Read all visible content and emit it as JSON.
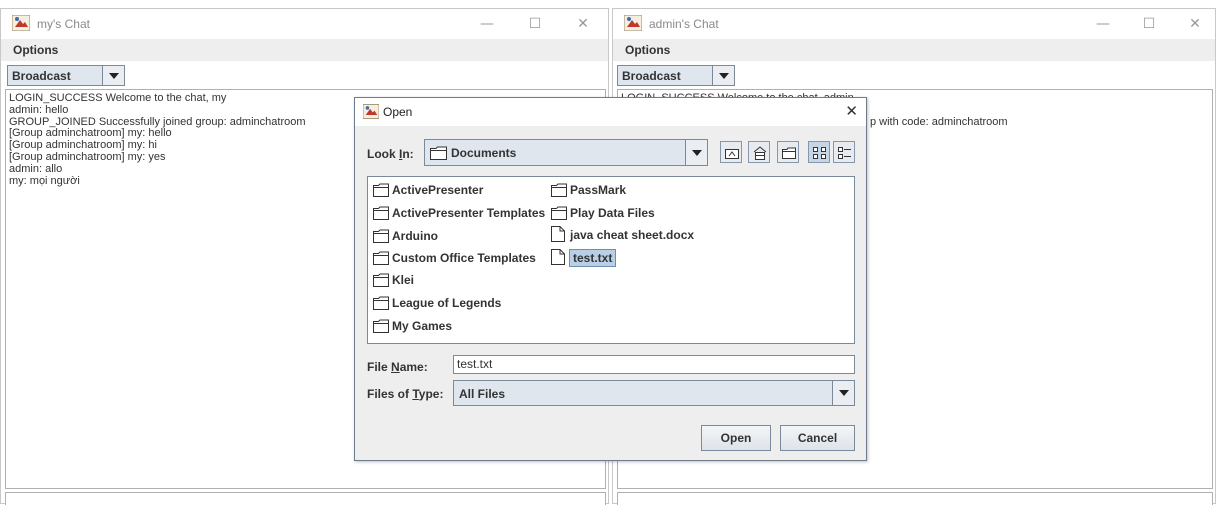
{
  "left_window": {
    "title": "my's Chat",
    "menu": "Options",
    "combo_value": "Broadcast",
    "chat_lines": [
      "LOGIN_SUCCESS Welcome to the chat, my",
      "admin: hello",
      "GROUP_JOINED Successfully joined group: adminchatroom",
      "[Group adminchatroom] my: hello",
      "[Group adminchatroom] my: hi",
      "[Group adminchatroom] my: yes",
      "admin: allo",
      "my: mọi người"
    ]
  },
  "right_window": {
    "title": "admin's Chat",
    "menu": "Options",
    "combo_value": "Broadcast",
    "chat_fragment_1": "LOGIN_SUCCESS Welcome to the chat, admin",
    "chat_fragment_2": "p with code: adminchatroom"
  },
  "window_controls": {
    "minimize": "—",
    "maximize": "☐",
    "close": "✕"
  },
  "dialog": {
    "title": "Open",
    "close": "✕",
    "look_in_label_prefix": "Look ",
    "look_in_label_mnemonic": "I",
    "look_in_label_suffix": "n:",
    "look_in_value": "Documents",
    "files": [
      {
        "name": "ActivePresenter",
        "type": "folder"
      },
      {
        "name": "ActivePresenter Templates",
        "type": "folder"
      },
      {
        "name": "Arduino",
        "type": "folder"
      },
      {
        "name": "Custom Office Templates",
        "type": "folder"
      },
      {
        "name": "Klei",
        "type": "folder"
      },
      {
        "name": "League of Legends",
        "type": "folder"
      },
      {
        "name": "My Games",
        "type": "folder"
      },
      {
        "name": "PassMark",
        "type": "folder"
      },
      {
        "name": "Play Data Files",
        "type": "folder"
      },
      {
        "name": "java cheat sheet.docx",
        "type": "file"
      },
      {
        "name": "test.txt",
        "type": "file",
        "selected": true
      }
    ],
    "file_name_label_prefix": "File ",
    "file_name_label_mnemonic": "N",
    "file_name_label_suffix": "ame:",
    "file_name_value": "test.txt",
    "file_type_label_prefix": "Files of ",
    "file_type_label_mnemonic": "T",
    "file_type_label_suffix": "ype:",
    "file_type_value": "All Files",
    "open_label": "Open",
    "cancel_label": "Cancel"
  }
}
